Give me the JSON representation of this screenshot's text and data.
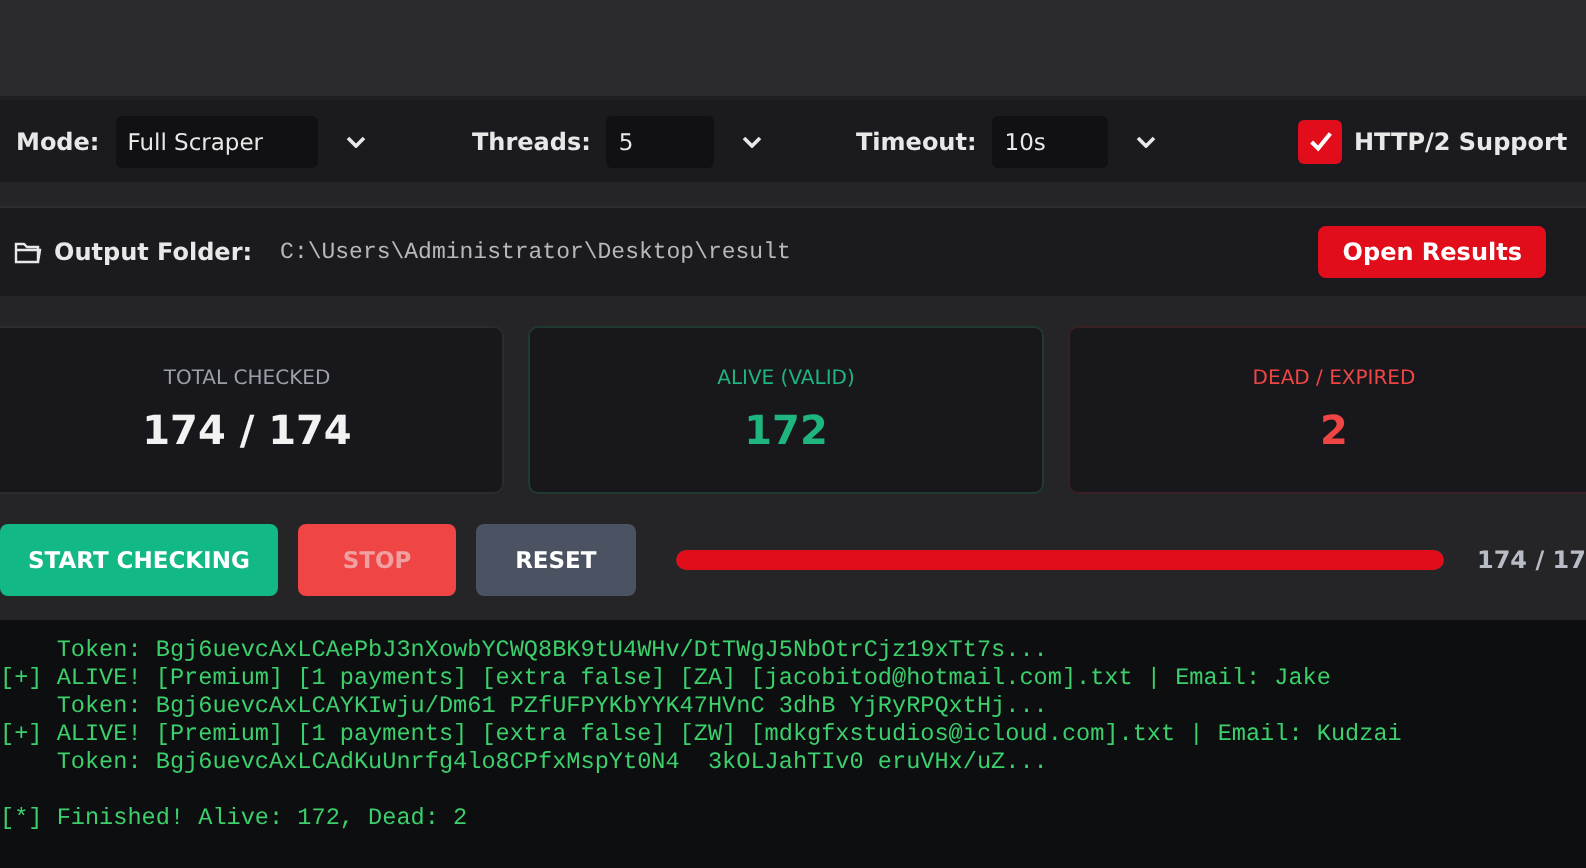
{
  "settings": {
    "selects": [
      {
        "label": "Mode:",
        "value": "Full Scraper"
      },
      {
        "label": "Threads:",
        "value": "5"
      },
      {
        "label": "Timeout:",
        "value": "10s"
      }
    ],
    "http2": {
      "label": "HTTP/2 Support",
      "checked": true
    }
  },
  "output": {
    "label": "Output Folder:",
    "path": "C:\\Users\\Administrator\\Desktop\\result",
    "button": "Open Results"
  },
  "stats": [
    {
      "kind": "total",
      "label": "TOTAL CHECKED",
      "value": "174 / 174"
    },
    {
      "kind": "alive",
      "label": "ALIVE (VALID)",
      "value": "172"
    },
    {
      "kind": "dead",
      "label": "DEAD / EXPIRED",
      "value": "2"
    }
  ],
  "controls": {
    "buttons": [
      {
        "kind": "start",
        "label": "START CHECKING",
        "disabled": false
      },
      {
        "kind": "stop",
        "label": "STOP",
        "disabled": true
      },
      {
        "kind": "reset",
        "label": "RESET",
        "disabled": false
      }
    ],
    "progress": {
      "level": 1,
      "reading": "174 / 17"
    }
  },
  "log": [
    {
      "lines": [
        "    Token: Bgj6uevcAxLCAePbJ3nXowbYCWQ8BK9tU4WHv/DtTWgJ5NbOtrCjz19xTt7s...",
        "[+] ALIVE! [Premium] [1 payments] [extra false] [ZA] [jacobitod@hotmail.com].txt | Email: Jake",
        "    Token: Bgj6uevcAxLCAYKIwju/Dm61 PZfUFPYKbYYK47HVnC 3dhB YjRyRPQxtHj...",
        "[+] ALIVE! [Premium] [1 payments] [extra false] [ZW] [mdkgfxstudios@icloud.com].txt | Email: Kudzai",
        "    Token: Bgj6uevcAxLCAdKuUnrfg4lo8CPfxMspYt0N4  3kOLJahTIv0 eruVHx/uZ..."
      ]
    },
    {
      "lines": [
        "[*] Finished! Alive: 172, Dead: 2"
      ]
    }
  ]
}
